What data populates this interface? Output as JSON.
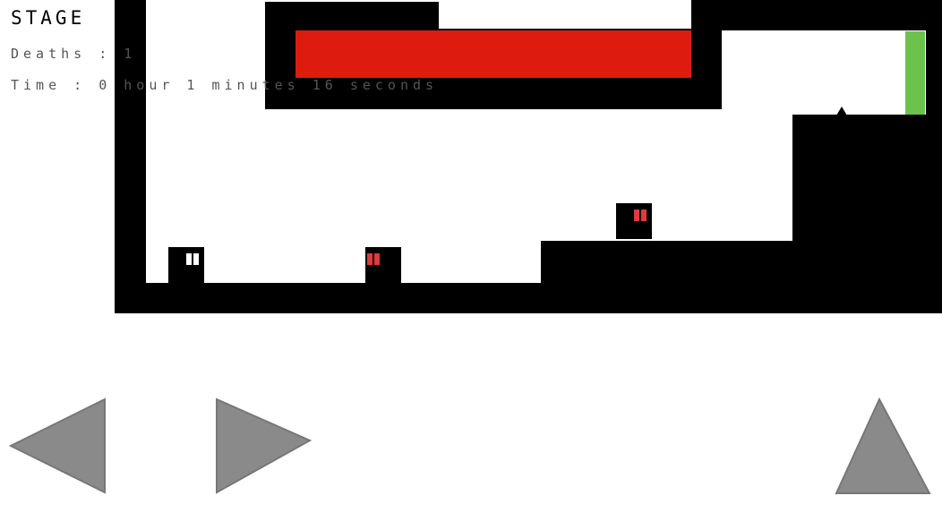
{
  "hud": {
    "stage_label": "STAGE",
    "deaths_text": "Deaths : 1",
    "time_text": "Time : 0 hour 1 minutes 16 seconds"
  },
  "colors": {
    "wall": "#000000",
    "hazard": "#dd1c0f",
    "goal": "#6cc24a",
    "player_eyes": "#ffffff",
    "enemy_eyes": "#e03a3a",
    "control_fill": "#8a8a8a"
  },
  "entities": {
    "player": {
      "type": "player-block",
      "eye_color": "white"
    },
    "enemies": [
      {
        "type": "enemy-block",
        "eye_color": "red"
      },
      {
        "type": "enemy-block",
        "eye_color": "red"
      }
    ]
  },
  "controls": {
    "left": "left-arrow-icon",
    "right": "right-arrow-icon",
    "jump": "up-triangle-icon"
  }
}
